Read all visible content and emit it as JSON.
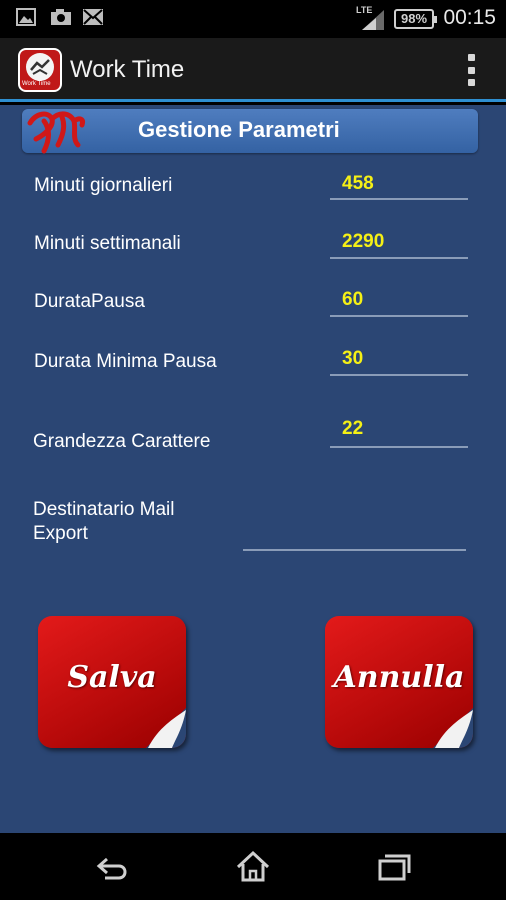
{
  "status_bar": {
    "battery": "98%",
    "time": "00:15",
    "network": "LTE"
  },
  "action_bar": {
    "title": "Work Time",
    "app_icon_text": "Work Time"
  },
  "form": {
    "header": "Gestione Parametri",
    "fields": [
      {
        "label": "Minuti giornalieri",
        "value": "458"
      },
      {
        "label": "Minuti settimanali",
        "value": "2290"
      },
      {
        "label": "DurataPausa",
        "value": "60"
      },
      {
        "label": "Durata Minima Pausa",
        "value": "30"
      },
      {
        "label": "Grandezza Carattere",
        "value": "22"
      }
    ],
    "mail_label_line1": "Destinatario Mail",
    "mail_label_line2": "Export",
    "mail_value": ""
  },
  "buttons": {
    "save": "Salva",
    "cancel": "Annulla"
  },
  "colors": {
    "background": "#2b4674",
    "header": "#3f6fb2",
    "value_text": "#f5f016",
    "button_red": "#d01010",
    "action_bar_accent": "#2e8fd1"
  }
}
